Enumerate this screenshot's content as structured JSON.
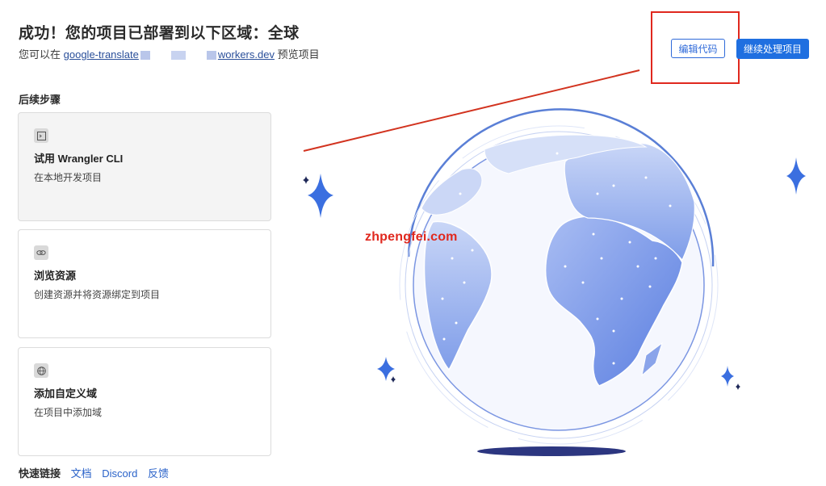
{
  "header": {
    "title": "成功！您的项目已部署到以下区域：全球",
    "subtitle_prefix": "您可以在",
    "link_start": "google-translate",
    "link_end": "workers.dev",
    "subtitle_suffix": "预览项目"
  },
  "actions": {
    "edit_code": "编辑代码",
    "continue": "继续处理项目"
  },
  "next_steps": {
    "heading": "后续步骤",
    "cards": [
      {
        "icon": "terminal-icon",
        "title": "试用 Wrangler CLI",
        "desc": "在本地开发项目"
      },
      {
        "icon": "link-icon",
        "title": "浏览资源",
        "desc": "创建资源并将资源绑定到项目"
      },
      {
        "icon": "globe-icon",
        "title": "添加自定义域",
        "desc": "在项目中添加域"
      }
    ]
  },
  "quick_links": {
    "label": "快速链接",
    "items": [
      "文档",
      "Discord",
      "反馈"
    ]
  },
  "watermark": "zhpengfei.com",
  "colors": {
    "accent": "#1f6fe0",
    "annotation_red": "#e0281e",
    "globe_land": "#6f8fe8",
    "globe_sea": "#f4f6fd"
  }
}
